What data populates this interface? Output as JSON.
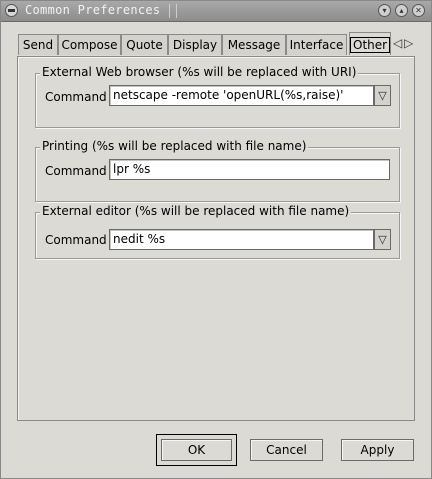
{
  "window": {
    "title": "Common Preferences"
  },
  "tabs": [
    {
      "label": "Send",
      "active": false
    },
    {
      "label": "Compose",
      "active": false
    },
    {
      "label": "Quote",
      "active": false
    },
    {
      "label": "Display",
      "active": false
    },
    {
      "label": "Message",
      "active": false
    },
    {
      "label": "Interface",
      "active": false
    },
    {
      "label": "Other",
      "active": true
    }
  ],
  "groups": {
    "web_browser": {
      "title": "External Web browser (%s will be replaced with URI)",
      "command_label": "Command",
      "command_value": "netscape -remote 'openURL(%s,raise)'"
    },
    "printing": {
      "title": "Printing (%s will be replaced with file name)",
      "command_label": "Command",
      "command_value": "lpr %s"
    },
    "editor": {
      "title": "External editor (%s will be replaced with file name)",
      "command_label": "Command",
      "command_value": "nedit  %s"
    }
  },
  "buttons": {
    "ok": "OK",
    "cancel": "Cancel",
    "apply": "Apply"
  }
}
